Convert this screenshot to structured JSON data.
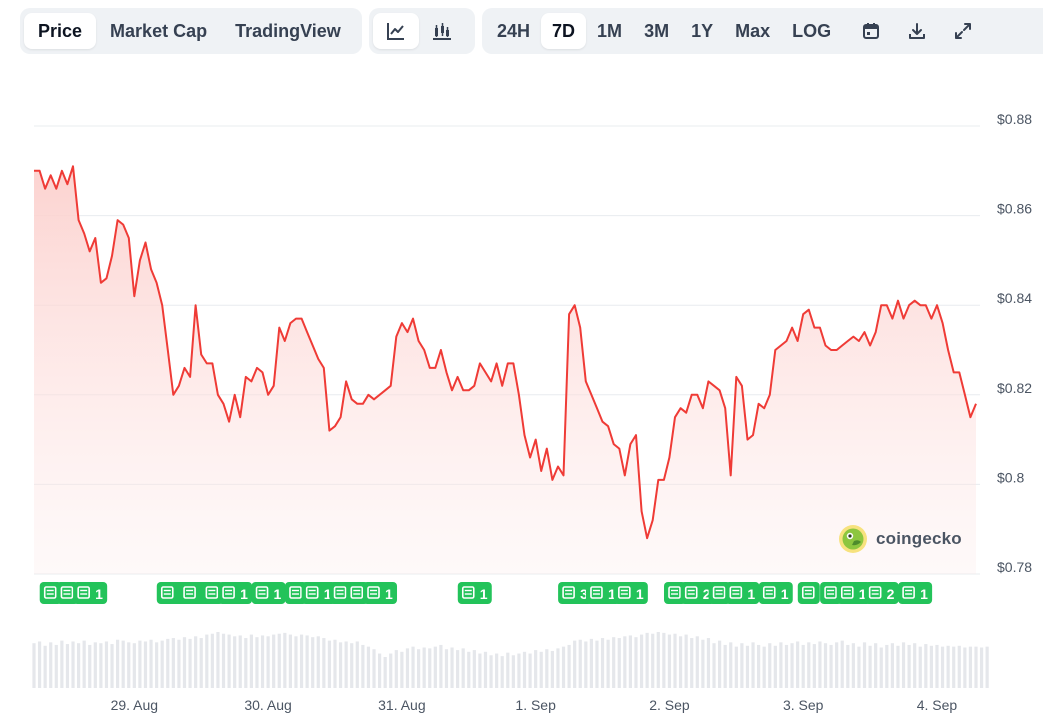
{
  "toolbar": {
    "view_tabs": [
      {
        "label": "Price",
        "active": true
      },
      {
        "label": "Market Cap",
        "active": false
      },
      {
        "label": "TradingView",
        "active": false
      }
    ],
    "chart_types": [
      {
        "icon": "line-chart-icon",
        "active": true
      },
      {
        "icon": "candlestick-chart-icon",
        "active": false
      }
    ],
    "ranges": [
      {
        "label": "24H",
        "active": false
      },
      {
        "label": "7D",
        "active": true
      },
      {
        "label": "1M",
        "active": false
      },
      {
        "label": "3M",
        "active": false
      },
      {
        "label": "1Y",
        "active": false
      },
      {
        "label": "Max",
        "active": false
      },
      {
        "label": "LOG",
        "active": false
      }
    ],
    "tools": [
      "calendar-icon",
      "download-icon",
      "expand-icon"
    ]
  },
  "watermark": {
    "text": "coingecko"
  },
  "colors": {
    "line": "#ef3b36",
    "fill_top": "#fde0de",
    "news_badge": "#23c35a",
    "volume": "#e5e7eb",
    "grid": "#e8ecef"
  },
  "chart_data": {
    "type": "area",
    "title": "",
    "xlabel": "",
    "ylabel": "",
    "ylim": [
      0.78,
      0.88
    ],
    "y_ticks": [
      "$0.88",
      "$0.86",
      "$0.84",
      "$0.82",
      "$0.8",
      "$0.78"
    ],
    "x_ticks": [
      "29. Aug",
      "30. Aug",
      "31. Aug",
      "1. Sep",
      "2. Sep",
      "3. Sep",
      "4. Sep"
    ],
    "x_range": [
      "28. Aug 06:00",
      "4. Sep 09:00"
    ],
    "grid": true,
    "series": [
      {
        "values": [
          0.87,
          0.87,
          0.866,
          0.869,
          0.866,
          0.87,
          0.867,
          0.871,
          0.859,
          0.856,
          0.852,
          0.855,
          0.845,
          0.846,
          0.851,
          0.859,
          0.858,
          0.855,
          0.842,
          0.85,
          0.854,
          0.848,
          0.845,
          0.84,
          0.83,
          0.82,
          0.822,
          0.826,
          0.824,
          0.84,
          0.829,
          0.827,
          0.827,
          0.82,
          0.818,
          0.814,
          0.82,
          0.815,
          0.824,
          0.823,
          0.826,
          0.825,
          0.82,
          0.822,
          0.835,
          0.832,
          0.836,
          0.837,
          0.837,
          0.834,
          0.831,
          0.828,
          0.826,
          0.812,
          0.813,
          0.815,
          0.823,
          0.819,
          0.818,
          0.818,
          0.82,
          0.819,
          0.82,
          0.821,
          0.822,
          0.833,
          0.836,
          0.834,
          0.837,
          0.832,
          0.83,
          0.826,
          0.826,
          0.83,
          0.825,
          0.821,
          0.824,
          0.821,
          0.821,
          0.822,
          0.827,
          0.825,
          0.823,
          0.827,
          0.822,
          0.827,
          0.827,
          0.82,
          0.811,
          0.806,
          0.81,
          0.803,
          0.808,
          0.801,
          0.804,
          0.802,
          0.838,
          0.84,
          0.835,
          0.823,
          0.82,
          0.817,
          0.814,
          0.813,
          0.809,
          0.808,
          0.802,
          0.809,
          0.811,
          0.794,
          0.788,
          0.792,
          0.801,
          0.801,
          0.806,
          0.815,
          0.817,
          0.816,
          0.82,
          0.82,
          0.817,
          0.823,
          0.822,
          0.821,
          0.817,
          0.802,
          0.824,
          0.822,
          0.81,
          0.811,
          0.818,
          0.817,
          0.82,
          0.83,
          0.831,
          0.832,
          0.835,
          0.832,
          0.838,
          0.839,
          0.835,
          0.835,
          0.831,
          0.83,
          0.83,
          0.831,
          0.832,
          0.833,
          0.832,
          0.834,
          0.831,
          0.834,
          0.84,
          0.84,
          0.837,
          0.841,
          0.837,
          0.84,
          0.841,
          0.84,
          0.84,
          0.837,
          0.84,
          0.836,
          0.83,
          0.825,
          0.825,
          0.82,
          0.815,
          0.818
        ],
        "volume": [
          0.52,
          0.54,
          0.49,
          0.53,
          0.5,
          0.55,
          0.51,
          0.54,
          0.52,
          0.55,
          0.5,
          0.53,
          0.52,
          0.54,
          0.51,
          0.56,
          0.55,
          0.53,
          0.52,
          0.55,
          0.54,
          0.56,
          0.53,
          0.55,
          0.57,
          0.58,
          0.56,
          0.59,
          0.57,
          0.6,
          0.58,
          0.62,
          0.63,
          0.65,
          0.63,
          0.62,
          0.6,
          0.61,
          0.58,
          0.62,
          0.59,
          0.61,
          0.6,
          0.62,
          0.63,
          0.64,
          0.62,
          0.6,
          0.62,
          0.61,
          0.59,
          0.6,
          0.58,
          0.55,
          0.56,
          0.53,
          0.54,
          0.52,
          0.54,
          0.5,
          0.48,
          0.45,
          0.4,
          0.36,
          0.4,
          0.44,
          0.42,
          0.46,
          0.48,
          0.45,
          0.47,
          0.46,
          0.48,
          0.5,
          0.45,
          0.47,
          0.44,
          0.46,
          0.42,
          0.44,
          0.4,
          0.42,
          0.38,
          0.4,
          0.37,
          0.41,
          0.38,
          0.4,
          0.42,
          0.4,
          0.44,
          0.42,
          0.45,
          0.43,
          0.46,
          0.48,
          0.5,
          0.55,
          0.56,
          0.54,
          0.57,
          0.55,
          0.58,
          0.56,
          0.59,
          0.58,
          0.6,
          0.61,
          0.59,
          0.62,
          0.64,
          0.63,
          0.65,
          0.64,
          0.62,
          0.63,
          0.6,
          0.62,
          0.58,
          0.6,
          0.56,
          0.58,
          0.52,
          0.55,
          0.5,
          0.53,
          0.48,
          0.52,
          0.49,
          0.53,
          0.5,
          0.48,
          0.52,
          0.49,
          0.53,
          0.5,
          0.52,
          0.54,
          0.5,
          0.53,
          0.51,
          0.54,
          0.52,
          0.5,
          0.53,
          0.55,
          0.5,
          0.52,
          0.48,
          0.53,
          0.49,
          0.52,
          0.47,
          0.5,
          0.52,
          0.49,
          0.53,
          0.5,
          0.52,
          0.48,
          0.51,
          0.49,
          0.5,
          0.48,
          0.49,
          0.48,
          0.49,
          0.47,
          0.48,
          0.48,
          0.47,
          0.48
        ]
      }
    ],
    "news_markers": [
      {
        "hour": 3,
        "count": ""
      },
      {
        "hour": 6,
        "count": ""
      },
      {
        "hour": 9,
        "count": "1"
      },
      {
        "hour": 24,
        "count": "1"
      },
      {
        "hour": 28,
        "count": "1"
      },
      {
        "hour": 32,
        "count": ""
      },
      {
        "hour": 35,
        "count": "1"
      },
      {
        "hour": 41,
        "count": "1"
      },
      {
        "hour": 47,
        "count": ""
      },
      {
        "hour": 50,
        "count": "1"
      },
      {
        "hour": 55,
        "count": "1"
      },
      {
        "hour": 58,
        "count": ""
      },
      {
        "hour": 61,
        "count": "1"
      },
      {
        "hour": 78,
        "count": "1"
      },
      {
        "hour": 96,
        "count": "3"
      },
      {
        "hour": 101,
        "count": "1"
      },
      {
        "hour": 106,
        "count": "1"
      },
      {
        "hour": 115,
        "count": ""
      },
      {
        "hour": 118,
        "count": "2"
      },
      {
        "hour": 123,
        "count": ""
      },
      {
        "hour": 126,
        "count": "1"
      },
      {
        "hour": 132,
        "count": "1"
      },
      {
        "hour": 139,
        "count": ""
      },
      {
        "hour": 143,
        "count": ""
      },
      {
        "hour": 146,
        "count": "1"
      },
      {
        "hour": 151,
        "count": "2"
      },
      {
        "hour": 157,
        "count": "1"
      }
    ]
  }
}
